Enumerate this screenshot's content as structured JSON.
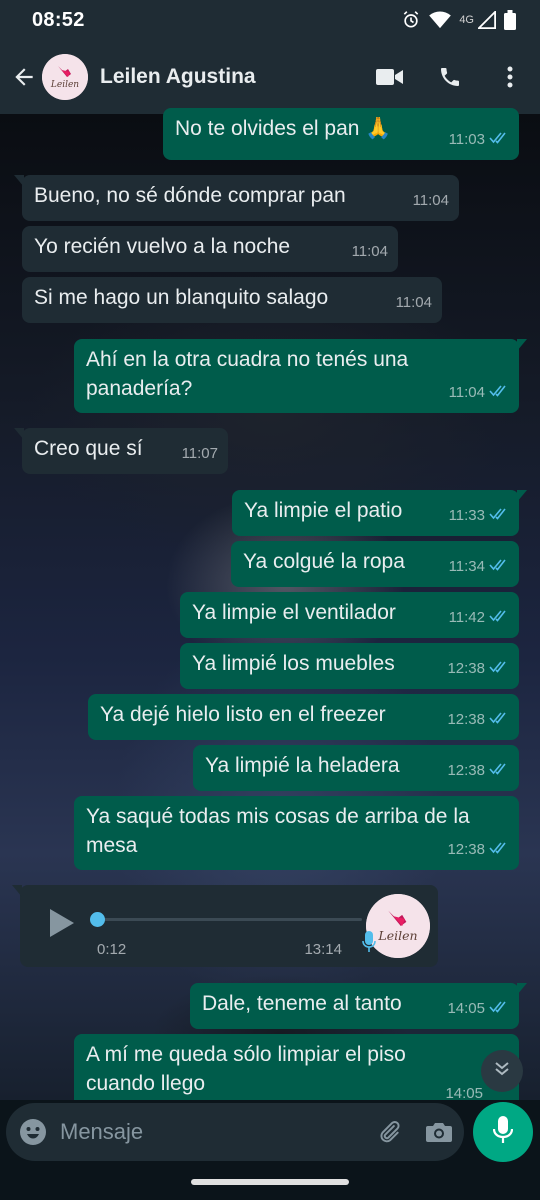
{
  "status_bar": {
    "time": "08:52",
    "network": "4G",
    "icons": [
      "alarm-icon",
      "wifi-icon",
      "signal-icon",
      "battery-icon"
    ]
  },
  "header": {
    "contact_name": "Leilen Agustina",
    "avatar_text": "Leilen",
    "actions": [
      "video-call-icon",
      "voice-call-icon",
      "more-options-icon"
    ]
  },
  "messages": [
    {
      "dir": "out",
      "text": "No te olvides el pan 🙏",
      "time": "11:03",
      "read": true
    },
    {
      "dir": "in",
      "text": "Bueno, no sé dónde comprar pan",
      "time": "11:04"
    },
    {
      "dir": "in",
      "text": "Yo recién vuelvo a la noche",
      "time": "11:04"
    },
    {
      "dir": "in",
      "text": "Si me hago un blanquito salago",
      "time": "11:04"
    },
    {
      "dir": "out",
      "text": "Ahí en la otra cuadra no tenés una panadería?",
      "time": "11:04",
      "read": true
    },
    {
      "dir": "in",
      "text": "Creo que sí",
      "time": "11:07"
    },
    {
      "dir": "out",
      "text": "Ya limpie el patio",
      "time": "11:33",
      "read": true
    },
    {
      "dir": "out",
      "text": "Ya colgué la ropa",
      "time": "11:34",
      "read": true
    },
    {
      "dir": "out",
      "text": "Ya limpie el ventilador",
      "time": "11:42",
      "read": true
    },
    {
      "dir": "out",
      "text": "Ya limpié los muebles",
      "time": "12:38",
      "read": true
    },
    {
      "dir": "out",
      "text": "Ya dejé hielo listo en el freezer",
      "time": "12:38",
      "read": true
    },
    {
      "dir": "out",
      "text": "Ya limpié la heladera",
      "time": "12:38",
      "read": true
    },
    {
      "dir": "out",
      "text": "Ya saqué todas mis cosas de arriba de la mesa",
      "time": "12:38",
      "read": true
    },
    {
      "dir": "out",
      "text": "Dale, teneme al tanto",
      "time": "14:05",
      "read": true
    },
    {
      "dir": "out",
      "text": "A mí me queda sólo limpiar el piso cuando llego",
      "time": "14:05",
      "read": true
    }
  ],
  "voice_note": {
    "duration": "0:12",
    "time": "13:14",
    "progress": 0,
    "avatar_text": "Leilen"
  },
  "composer": {
    "placeholder": "Mensaje"
  },
  "colors": {
    "outgoing": "#005c4b",
    "incoming": "#1f2c34",
    "accent": "#00a884",
    "read_ticks": "#53bdeb"
  }
}
